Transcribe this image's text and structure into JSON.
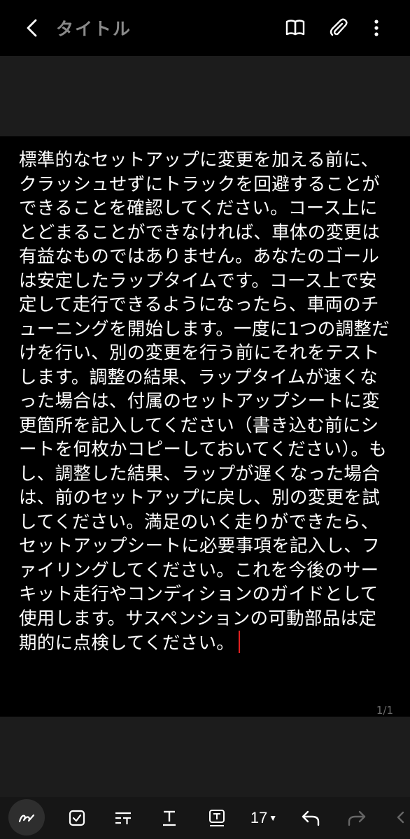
{
  "header": {
    "title": "タイトル",
    "icons": [
      "back-arrow-icon",
      "book-view-icon",
      "paperclip-icon",
      "more-vertical-icon"
    ]
  },
  "note": {
    "body": "標準的なセットアップに変更を加える前に、クラッシュせずにトラックを回避することができることを確認してください。コース上にとどまることができなければ、車体の変更は有益なものではありません。あなたのゴールは安定したラップタイムです。コース上で安定して走行できるようになったら、車両のチューニングを開始します。一度に1つの調整だけを行い、別の変更を行う前にそれをテストします。調整の結果、ラップタイムが速くなった場合は、付属のセットアップシートに変更箇所を記入してください（書き込む前にシートを何枚かコピーしておいてください）。もし、調整した結果、ラップが遅くなった場合は、前のセットアップに戻し、別の変更を試してください。満足のいく走りができたら、セットアップシートに必要事項を記入し、ファイリングしてください。これを今後のサーキット走行やコンディションのガイドとして使用します。サスペンションの可動部品は定期的に点検してください。",
    "page_indicator": "1/1"
  },
  "toolbar": {
    "font_size": "17",
    "icons": [
      "pen-icon",
      "checkbox-icon",
      "text-style-icon",
      "text-format-icon",
      "text-box-icon",
      "undo-icon",
      "redo-icon",
      "more-icon"
    ]
  },
  "colors": {
    "background": "#000000",
    "title_gray": "#8a8a8a",
    "cursor": "#e02020"
  }
}
